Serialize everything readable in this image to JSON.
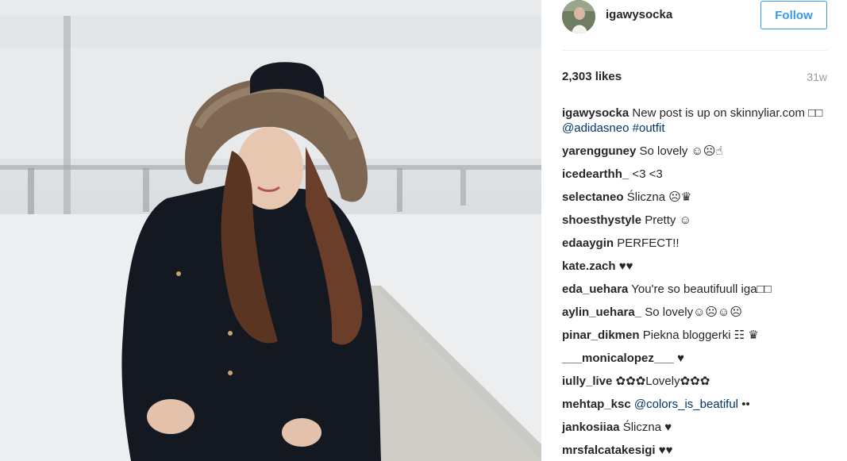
{
  "post": {
    "username": "igawysocka",
    "follow_label": "Follow",
    "likes": "2,303 likes",
    "age": "31w"
  },
  "caption": {
    "user": "igawysocka",
    "text": "New post is up on skinnyliar.com □□ ",
    "mention": "@adidasneo",
    "hashtag": "#outfit"
  },
  "comments": [
    {
      "user": "yarengguney",
      "text": "So lovely ☺☹☝"
    },
    {
      "user": "icedearthh_",
      "text": "<3 <3"
    },
    {
      "user": "selectaneo",
      "text": "Śliczna ☹♛"
    },
    {
      "user": "shoesthystyle",
      "text": "Pretty ☺"
    },
    {
      "user": "edaaygin",
      "text": "PERFECT!!"
    },
    {
      "user": "kate.zach",
      "text": "♥♥"
    },
    {
      "user": "eda_uehara",
      "text": "You're so beautifuull iga□□"
    },
    {
      "user": "aylin_uehara_",
      "text": "So lovely☺☹☺☹"
    },
    {
      "user": "pinar_dikmen",
      "text": "Piekna bloggerki ☷ ♛"
    },
    {
      "user": "___monicalopez___",
      "text": "♥"
    },
    {
      "user": "iully_live",
      "text": "✿✿✿Lovely✿✿✿"
    },
    {
      "user": "mehtap_ksc",
      "mention": "@colors_is_beatiful",
      "text": "••"
    },
    {
      "user": "jankosiiaa",
      "text": "Śliczna ♥"
    },
    {
      "user": "mrsfalcatakesigi",
      "text": "♥♥"
    }
  ],
  "colors": {
    "link": "#003569",
    "follow_blue": "#3897f0",
    "muted": "#999999"
  },
  "icons": {
    "avatar": "profile-photo",
    "photo": "woman-in-parka-on-pier"
  }
}
